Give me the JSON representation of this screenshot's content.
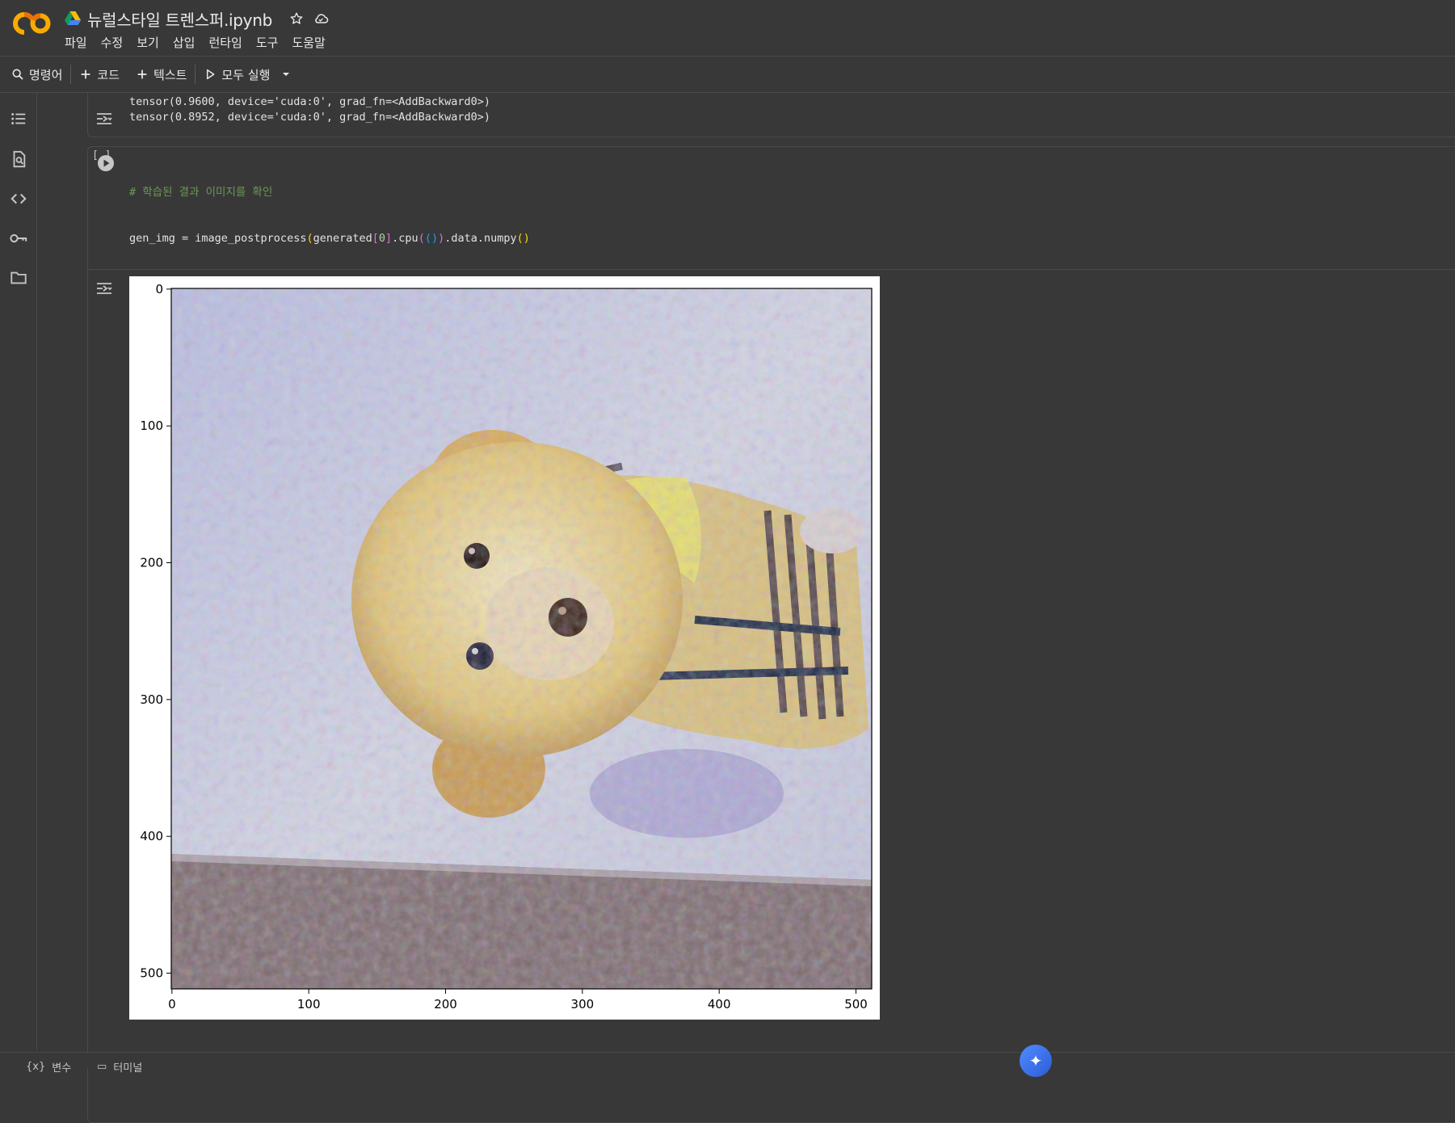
{
  "app": {
    "doc_title": "뉴럴스타일 트렌스퍼.ipynb",
    "menu": [
      "파일",
      "수정",
      "보기",
      "삽입",
      "런타임",
      "도구",
      "도움말"
    ]
  },
  "toolbar": {
    "commands_label": "명령어",
    "code_label": "코드",
    "text_label": "텍스트",
    "run_all_label": "모두 실행"
  },
  "cells": {
    "prev_output": [
      "tensor(0.9600, device='cuda:0', grad_fn=<AddBackward0>)",
      "tensor(0.8952, device='cuda:0', grad_fn=<AddBackward0>)"
    ],
    "exec_bracket": "[ ]"
  },
  "plot": {
    "x_ticks": [
      "0",
      "100",
      "200",
      "300",
      "400",
      "500"
    ],
    "y_ticks": [
      "0",
      "100",
      "200",
      "300",
      "400",
      "500"
    ]
  },
  "chart_data": {
    "type": "image",
    "title": "",
    "xlabel": "",
    "ylabel": "",
    "xlim": [
      0,
      512
    ],
    "ylim": [
      512,
      0
    ],
    "x_ticks": [
      0,
      100,
      200,
      300,
      400,
      500
    ],
    "y_ticks": [
      0,
      100,
      200,
      300,
      400,
      500
    ]
  },
  "bottom": {
    "variables_label": "변수",
    "terminal_label": "터미널"
  },
  "icons": {
    "rail": [
      "toc-icon",
      "find-icon",
      "code-snippets-icon",
      "secrets-key-icon",
      "files-folder-icon"
    ]
  },
  "colors": {
    "background": "#383838",
    "code_comment": "#6a9955",
    "code_number": "#b5cea8",
    "paren1": "#ffd700",
    "paren2": "#da70d6",
    "paren3": "#179fff"
  }
}
